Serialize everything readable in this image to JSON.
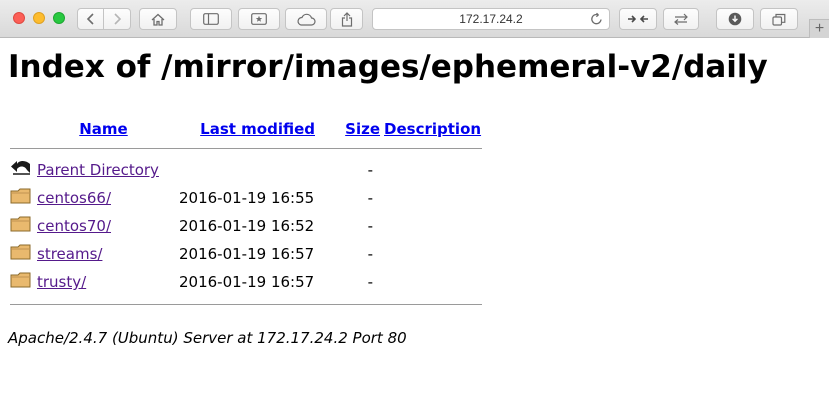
{
  "browser": {
    "address": "172.17.24.2",
    "new_tab_label": "+"
  },
  "page": {
    "title": "Index of /mirror/images/ephemeral-v2/daily",
    "columns": {
      "name": "Name",
      "last_modified": "Last modified",
      "size": "Size",
      "description": "Description"
    },
    "rows": [
      {
        "icon": "back-icon",
        "name": "Parent Directory",
        "modified": "",
        "size": "-"
      },
      {
        "icon": "folder-icon",
        "name": "centos66/",
        "modified": "2016-01-19 16:55",
        "size": "-"
      },
      {
        "icon": "folder-icon",
        "name": "centos70/",
        "modified": "2016-01-19 16:52",
        "size": "-"
      },
      {
        "icon": "folder-icon",
        "name": "streams/",
        "modified": "2016-01-19 16:57",
        "size": "-"
      },
      {
        "icon": "folder-icon",
        "name": "trusty/",
        "modified": "2016-01-19 16:57",
        "size": "-"
      }
    ],
    "footer": "Apache/2.4.7 (Ubuntu) Server at 172.17.24.2 Port 80"
  },
  "colors": {
    "link": "#0000ee",
    "visited_link": "#551a8b",
    "folder": "#e9b96e"
  }
}
